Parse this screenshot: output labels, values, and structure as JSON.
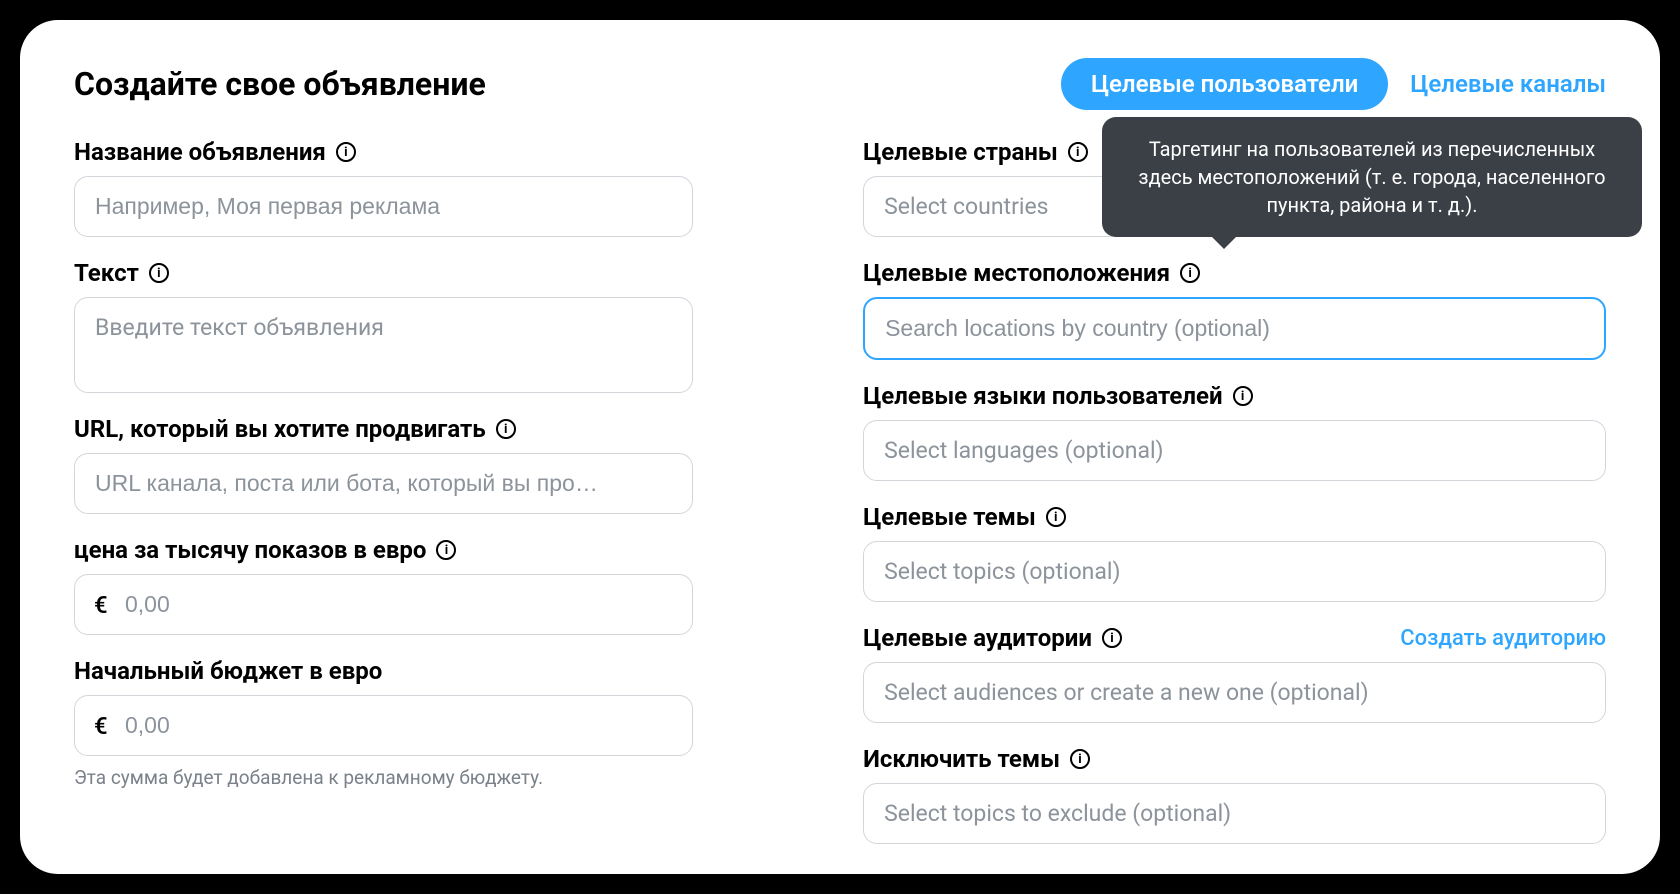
{
  "header": {
    "title": "Создайте свое объявление",
    "tabs": {
      "users": "Целевые пользователи",
      "channels": "Целевые каналы"
    }
  },
  "left": {
    "ad_name": {
      "label": "Название объявления",
      "placeholder": "Например, Моя первая реклама"
    },
    "text": {
      "label": "Текст",
      "placeholder": "Введите текст объявления"
    },
    "url": {
      "label": "URL, который вы хотите продвигать",
      "placeholder": "URL канала, поста или бота, который вы про…"
    },
    "cpm": {
      "label": "цена за тысячу показов в евро",
      "currency": "€",
      "placeholder": "0,00"
    },
    "budget": {
      "label": "Начальный бюджет в евро",
      "currency": "€",
      "placeholder": "0,00",
      "helper": "Эта сумма будет добавлена к рекламному бюджету."
    }
  },
  "right": {
    "countries": {
      "label": "Целевые страны",
      "placeholder": "Select countries"
    },
    "locations": {
      "label": "Целевые местоположения",
      "placeholder": "Search locations by country (optional)",
      "tooltip": "Таргетинг на пользователей из перечисленных здесь местоположений (т. е. города, населенного пункта, района и т. д.)."
    },
    "languages": {
      "label": "Целевые языки пользователей",
      "placeholder": "Select languages (optional)"
    },
    "topics": {
      "label": "Целевые темы",
      "placeholder": "Select topics (optional)"
    },
    "audiences": {
      "label": "Целевые аудитории",
      "placeholder": "Select audiences or create a new one (optional)",
      "create_link": "Создать аудиторию"
    },
    "exclude": {
      "label": "Исключить темы",
      "placeholder": "Select topics to exclude (optional)"
    }
  }
}
